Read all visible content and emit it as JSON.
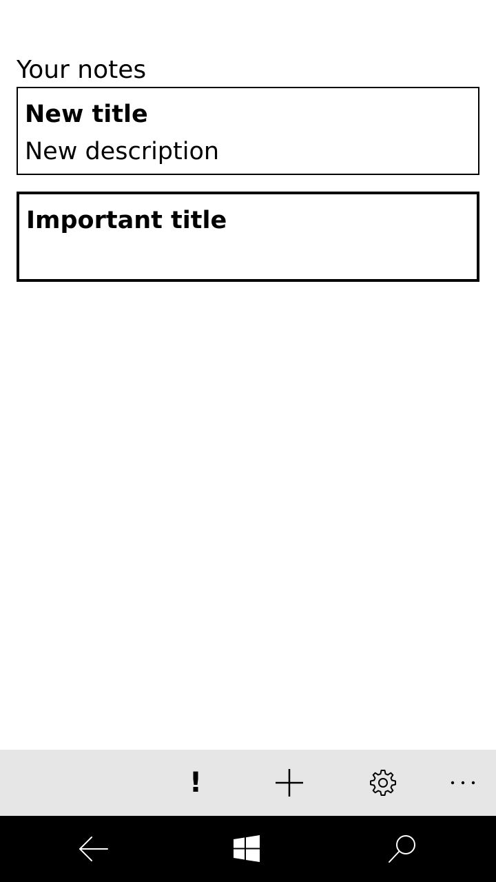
{
  "page": {
    "title": "Your notes"
  },
  "notes": [
    {
      "title": "New title",
      "description": "New description",
      "important": false
    },
    {
      "title": "Important title",
      "description": "",
      "important": true
    }
  ],
  "app_bar": {
    "buttons": [
      {
        "icon": "exclamation-icon",
        "glyph": "!"
      },
      {
        "icon": "add-icon"
      },
      {
        "icon": "gear-icon"
      },
      {
        "icon": "more-icon"
      }
    ]
  },
  "nav_bar": {
    "buttons": [
      {
        "icon": "back-arrow-icon"
      },
      {
        "icon": "windows-icon"
      },
      {
        "icon": "search-icon"
      }
    ]
  },
  "colors": {
    "background": "#ffffff",
    "app_bar": "#e6e6e6",
    "nav_bar": "#000000",
    "text": "#000000",
    "nav_icon": "#ffffff"
  }
}
